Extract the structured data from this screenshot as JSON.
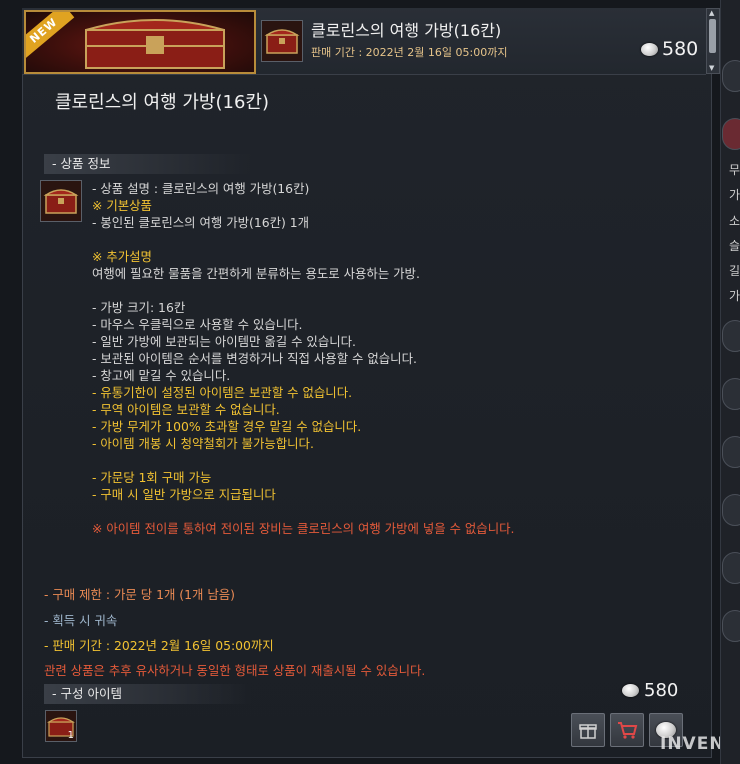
{
  "banner": {
    "new_label": "NEW",
    "title": "클로린스의 여행 가방(16칸)",
    "sale_period": "판매 기간 : 2022년 2월 16일 05:00까지",
    "price": "580"
  },
  "heading": "클로린스의 여행 가방(16칸)",
  "product_section": {
    "label": "- 상품 정보"
  },
  "description": [
    {
      "text": "- 상품 설명 : 클로린스의 여행 가방(16칸)",
      "color": "white"
    },
    {
      "text": "※ 기본상품",
      "color": "yellow"
    },
    {
      "text": "- 봉인된 클로린스의 여행 가방(16칸) 1개",
      "color": "white"
    },
    {
      "text": "",
      "color": "gap"
    },
    {
      "text": "※ 추가설명",
      "color": "yellow"
    },
    {
      "text": "여행에 필요한 물품을 간편하게 분류하는 용도로 사용하는 가방.",
      "color": "white"
    },
    {
      "text": "",
      "color": "gap"
    },
    {
      "text": "- 가방 크기: 16칸",
      "color": "white"
    },
    {
      "text": "- 마우스 우클릭으로 사용할 수 있습니다.",
      "color": "white"
    },
    {
      "text": "- 일반 가방에 보관되는 아이템만 옮길 수 있습니다.",
      "color": "white"
    },
    {
      "text": "- 보관된 아이템은 순서를 변경하거나 직접 사용할 수 없습니다.",
      "color": "white"
    },
    {
      "text": "- 창고에 맡길 수 있습니다.",
      "color": "white"
    },
    {
      "text": "- 유통기한이 설정된 아이템은 보관할 수 없습니다.",
      "color": "yellow"
    },
    {
      "text": "- 무역 아이템은 보관할 수 없습니다.",
      "color": "yellow"
    },
    {
      "text": "- 가방 무게가 100% 초과할 경우 맡길 수 없습니다.",
      "color": "yellow"
    },
    {
      "text": "- 아이템 개봉 시 청약철회가 불가능합니다.",
      "color": "yellow"
    },
    {
      "text": "",
      "color": "gap"
    },
    {
      "text": "- 가문당 1회 구매 가능",
      "color": "yellow"
    },
    {
      "text": "- 구매 시 일반 가방으로 지급됩니다",
      "color": "yellow"
    },
    {
      "text": "",
      "color": "gap"
    },
    {
      "text": "※ 아이템 전이를 통하여 전이된 장비는 클로린스의 여행 가방에 넣을 수 없습니다.",
      "color": "red"
    }
  ],
  "info": {
    "purchase_limit": "- 구매 제한 : 가문 당 1개 (1개 남음)",
    "bound": "- 획득 시 귀속",
    "sale_period": "- 판매 기간 : 2022년 2월 16일 05:00까지",
    "notice": "관련 상품은 추후 유사하거나 동일한 형태로 상품이 재출시될 수 있습니다."
  },
  "components_section": {
    "label": "- 구성 아이템",
    "count": "1"
  },
  "bottom_price": "580",
  "side_text": [
    "무",
    "가",
    "소",
    "슬",
    "길",
    "가"
  ],
  "watermark": "INVEN",
  "colors": {
    "yellow": "#f1c232",
    "red": "#e45a3a",
    "orange": "#ea8a54",
    "blue": "#9fb6cc",
    "white": "#d7d7d7"
  }
}
